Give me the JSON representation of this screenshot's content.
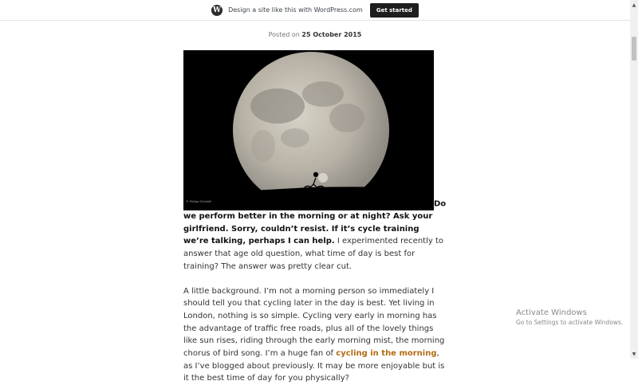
{
  "banner": {
    "logo_glyph": "W",
    "text": "Design a site like this with WordPress.com",
    "cta_label": "Get started"
  },
  "post": {
    "posted_prefix": "Posted on",
    "date": "25 October 2015",
    "image_credit": "© Philipp Schmidli",
    "lead_text": "Do we perform better in the morning or at night? Ask your girlfriend. Sorry, couldn’t resist. If it’s cycle training we’re talking, perhaps I can help.",
    "para1_rest": " I ex­perimented recently to answer that age old question, what time of day is best for training? The answer was pretty clear cut.",
    "para2_before": "A little background. I’m not a morning person so immediately I should tell you that cycling later in the day is best. Yet living in London, nothing is so simple. Cycling very early in morning has the advantage of traffic free roads, plus all of the lovely things like sun rises, riding through the early morning mist, the morning chorus of bird song. I’m a huge fan of ",
    "para2_link": "cycling in the morning",
    "para2_after": ", as I’ve blogged about previously. It may be more enjoyable but is it the best time of day for you physically?"
  },
  "watermark": {
    "title": "Activate Windows",
    "subtitle": "Go to Settings to activate Windows."
  },
  "colors": {
    "link": "#b36b12",
    "banner_button": "#1e1e1e"
  }
}
